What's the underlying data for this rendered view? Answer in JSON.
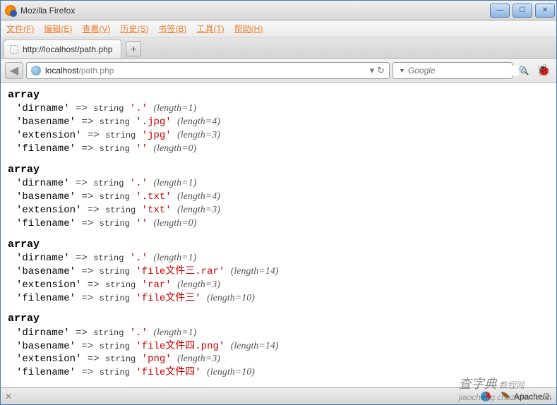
{
  "window": {
    "title": "Mozilla Firefox"
  },
  "menubar": [
    "文件(F)",
    "编辑(E)",
    "查看(V)",
    "历史(S)",
    "书签(B)",
    "工具(T)",
    "帮助(H)"
  ],
  "tab": {
    "title": "http://localhost/path.php"
  },
  "urlbar": {
    "host": "localhost",
    "path": "/path.php"
  },
  "searchbar": {
    "placeholder": "Google"
  },
  "statusbar": {
    "server": "Apache/2."
  },
  "watermark": {
    "cn": "查字典",
    "sub": "教程网",
    "url": "jiaocheng.chazidian.com"
  },
  "arrays": [
    {
      "label": "array",
      "rows": [
        {
          "key": "dirname",
          "type": "string",
          "val": ".",
          "len": 1
        },
        {
          "key": "basename",
          "type": "string",
          "val": ".jpg",
          "len": 4
        },
        {
          "key": "extension",
          "type": "string",
          "val": "jpg",
          "len": 3
        },
        {
          "key": "filename",
          "type": "string",
          "val": "",
          "len": 0
        }
      ]
    },
    {
      "label": "array",
      "rows": [
        {
          "key": "dirname",
          "type": "string",
          "val": ".",
          "len": 1
        },
        {
          "key": "basename",
          "type": "string",
          "val": ".txt",
          "len": 4
        },
        {
          "key": "extension",
          "type": "string",
          "val": "txt",
          "len": 3
        },
        {
          "key": "filename",
          "type": "string",
          "val": "",
          "len": 0
        }
      ]
    },
    {
      "label": "array",
      "rows": [
        {
          "key": "dirname",
          "type": "string",
          "val": ".",
          "len": 1
        },
        {
          "key": "basename",
          "type": "string",
          "val": "file文件三.rar",
          "len": 14
        },
        {
          "key": "extension",
          "type": "string",
          "val": "rar",
          "len": 3
        },
        {
          "key": "filename",
          "type": "string",
          "val": "file文件三",
          "len": 10
        }
      ]
    },
    {
      "label": "array",
      "rows": [
        {
          "key": "dirname",
          "type": "string",
          "val": ".",
          "len": 1
        },
        {
          "key": "basename",
          "type": "string",
          "val": "file文件四.png",
          "len": 14
        },
        {
          "key": "extension",
          "type": "string",
          "val": "png",
          "len": 3
        },
        {
          "key": "filename",
          "type": "string",
          "val": "file文件四",
          "len": 10
        }
      ]
    }
  ]
}
